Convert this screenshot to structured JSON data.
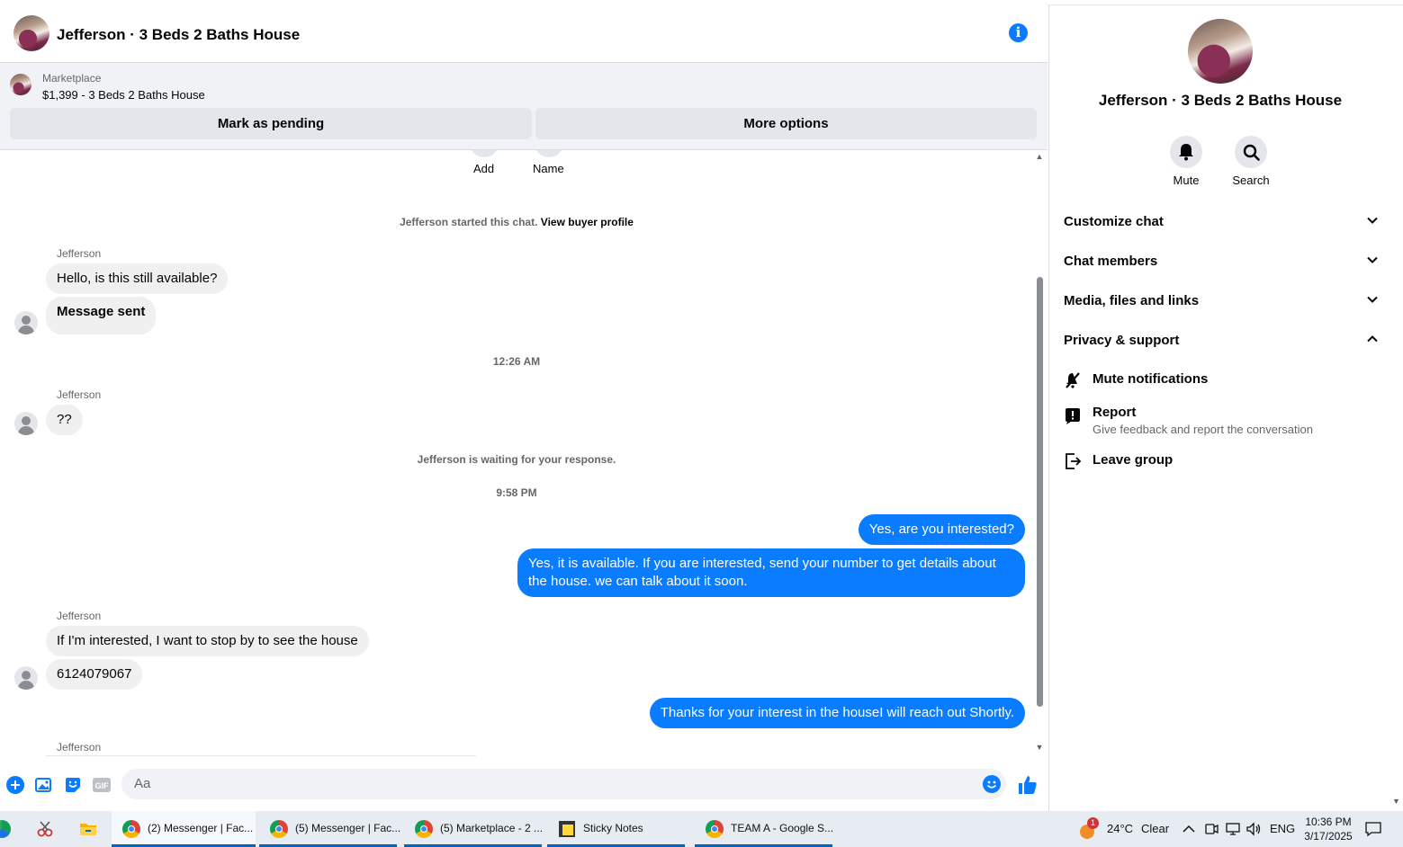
{
  "header": {
    "title": "Jefferson · 3 Beds 2 Baths House"
  },
  "listing": {
    "label": "Marketplace",
    "title": "$1,399 - 3 Beds 2 Baths House",
    "pending_label": "Mark as pending",
    "more_label": "More options"
  },
  "chat": {
    "top_actions": [
      "Add",
      "Name"
    ],
    "started_text": "Jefferson started this chat.",
    "started_link": "View buyer profile",
    "sender": "Jefferson",
    "msg1": "Hello, is this still available?",
    "msg2": "Message sent",
    "time1": "12:26 AM",
    "msg3": "??",
    "waiting": "Jefferson is waiting for your response.",
    "time2": "9:58 PM",
    "out1": "Yes, are you interested?",
    "out2": "Yes, it is available. If you are interested, send your number to get details about the house. we can talk about it soon.",
    "msg4": "If I'm interested, I want to stop by to see the house",
    "msg5": "6124079067",
    "out3": "Thanks for your interest in the houseI will reach out Shortly."
  },
  "composer": {
    "placeholder": "Aa"
  },
  "sidebar": {
    "title": "Jefferson · 3 Beds 2 Baths House",
    "mute_label": "Mute",
    "search_label": "Search",
    "sections": [
      "Customize chat",
      "Chat members",
      "Media, files and links",
      "Privacy & support"
    ],
    "mute_notifications": "Mute notifications",
    "report": "Report",
    "report_sub": "Give feedback and report the conversation",
    "leave": "Leave group"
  },
  "taskbar": {
    "apps": [
      "(2) Messenger | Fac...",
      "(5) Messenger | Fac...",
      "(5) Marketplace - 2 ...",
      "Sticky Notes",
      "TEAM A - Google S..."
    ],
    "weather_badge": "1",
    "temperature": "24°C",
    "weather": "Clear",
    "language": "ENG",
    "time": "10:36 PM",
    "date": "3/17/2025"
  },
  "colors": {
    "accent": "#0a7cff",
    "incoming": "#f0f0f0",
    "secondary_text": "#65676b"
  }
}
